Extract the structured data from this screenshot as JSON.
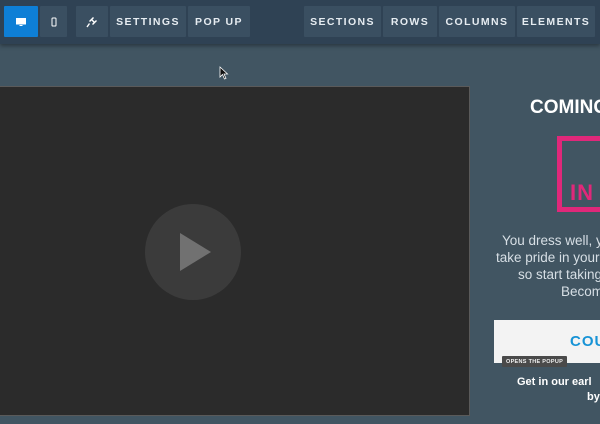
{
  "toolbar": {
    "devices": [
      {
        "name": "desktop-icon",
        "active": true
      },
      {
        "name": "mobile-icon",
        "active": false
      }
    ],
    "left_buttons": [
      "SETTINGS",
      "POP UP"
    ],
    "right_buttons": [
      "SECTIONS",
      "ROWS",
      "COLUMNS",
      "ELEMENTS"
    ],
    "plugin_icon": "plug-icon"
  },
  "video": {
    "play_icon": "play-icon"
  },
  "promo": {
    "title": "COMING",
    "accent_text": "IN",
    "description": [
      "You dress well, y",
      "take pride in your",
      "so start taking",
      "Becom"
    ],
    "cta_label": "COU",
    "badge": "OPENS THE POPUP",
    "note": [
      "Get in our earl",
      "by"
    ]
  },
  "colors": {
    "active_blue": "#0e7fd6",
    "accent_pink": "#e0287a",
    "cta_blue": "#1793d6",
    "background": "#415562"
  }
}
